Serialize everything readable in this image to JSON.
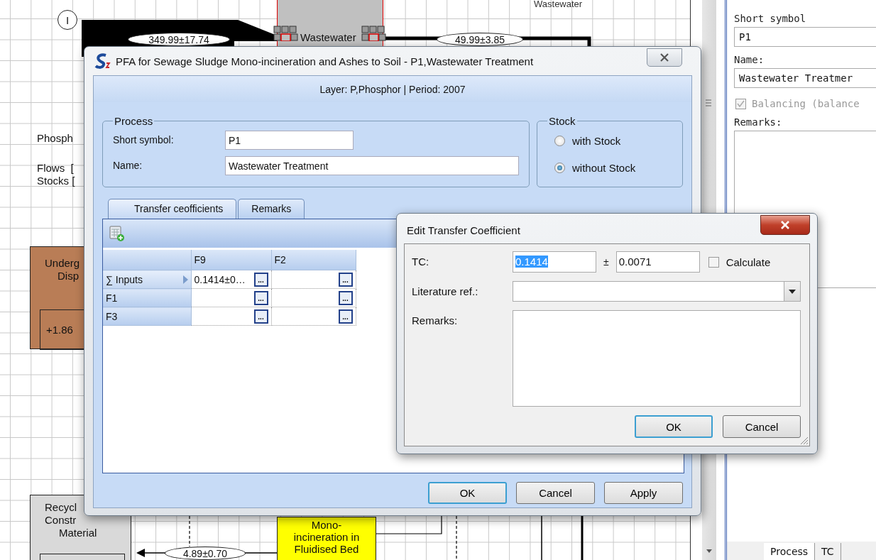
{
  "canvas": {
    "top_label": "Wastewater",
    "input_marker": "I",
    "legend": [
      "Phosph",
      "Flows  [",
      "Stocks ["
    ],
    "processes": [
      {
        "kind": "process",
        "lines": [
          "Wastewater"
        ],
        "color": "#c0c0c0",
        "selected": true
      },
      {
        "kind": "process_with_stock",
        "lines": [
          "Underg",
          "Disp"
        ],
        "color": "#b97d56",
        "selected": false,
        "stock": "+1.86"
      },
      {
        "kind": "process_with_stock",
        "lines": [
          "Recycl",
          "Constr",
          "Material"
        ],
        "color": "#d9d9d9",
        "selected": false
      },
      {
        "kind": "process",
        "lines": [
          "Mono-",
          "incineration in",
          "Fluidised Bed"
        ],
        "color": "#ffff00",
        "selected": false
      }
    ],
    "flows": [
      {
        "value": "349.99±17.74"
      },
      {
        "value": "49.99±3.85"
      },
      {
        "value": "4.89±0.70"
      }
    ]
  },
  "process_dialog": {
    "title": "PFA for Sewage Sludge Mono-incineration and Ashes to Soil - P1,Wastewater Treatment",
    "layer_info": "Layer: P,Phosphor | Period: 2007",
    "process_group": {
      "legend": "Process",
      "fields": [
        {
          "label": "Short symbol:",
          "value": "P1"
        },
        {
          "label": "Name:",
          "value": "Wastewater Treatment"
        }
      ]
    },
    "stock_group": {
      "legend": "Stock",
      "options": [
        {
          "label": "with Stock",
          "selected": false
        },
        {
          "label": "without Stock",
          "selected": true
        }
      ]
    },
    "tabs": [
      {
        "label": "Transfer ceofficients",
        "selected": true
      },
      {
        "label": "Remarks",
        "selected": false
      }
    ],
    "grid": {
      "columns": [
        "F9",
        "F2"
      ],
      "rows": [
        {
          "header": "∑ Inputs",
          "current": true,
          "cells": [
            {
              "value": "0.1414±0…",
              "button": "..."
            },
            {
              "button": "..."
            }
          ]
        },
        {
          "header": "F1",
          "current": false,
          "cells": [
            {
              "button": "..."
            },
            {
              "button": "..."
            }
          ]
        },
        {
          "header": "F3",
          "current": false,
          "cells": [
            {
              "button": "..."
            },
            {
              "button": "..."
            }
          ]
        }
      ]
    },
    "buttons": [
      {
        "label": "OK",
        "focused": true
      },
      {
        "label": "Cancel",
        "focused": false
      },
      {
        "label": "Apply",
        "focused": false
      }
    ]
  },
  "tc_dialog": {
    "title": "Edit Transfer Coefficient",
    "tc": {
      "label": "TC:",
      "value": "0.1414",
      "value_selected": true
    },
    "plus_minus": "±",
    "uncertainty": "0.0071",
    "calculate": {
      "label": "Calculate",
      "checked": false
    },
    "literature": {
      "label": "Literature ref.:"
    },
    "remarks": {
      "label": "Remarks:"
    },
    "buttons": [
      {
        "label": "OK",
        "focused": true
      },
      {
        "label": "Cancel",
        "focused": false
      }
    ]
  },
  "properties": {
    "short_symbol": {
      "label": "Short symbol",
      "value": "P1"
    },
    "name": {
      "label": "Name:",
      "value": "Wastewater Treatmer"
    },
    "balancing": {
      "label": "Balancing (balance",
      "checked": true,
      "disabled": true
    },
    "remarks": {
      "label": "Remarks:"
    },
    "tabs": [
      {
        "label": "Process",
        "selected": true
      },
      {
        "label": "TC",
        "selected": false
      }
    ]
  }
}
